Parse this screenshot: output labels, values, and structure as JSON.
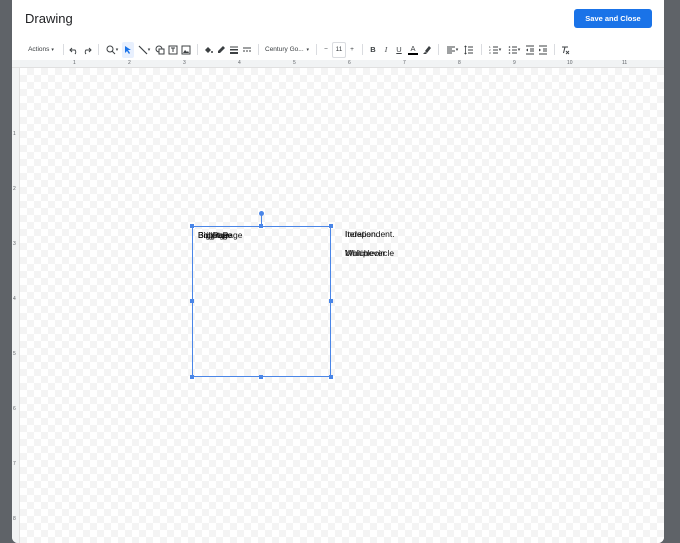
{
  "dialog": {
    "title": "Drawing",
    "save_close_label": "Save and Close"
  },
  "toolbar": {
    "actions_label": "Actions",
    "font_name": "Century Go...",
    "font_size": "11",
    "font_size_minus": "−",
    "font_size_plus": "+",
    "bold": "B",
    "italic": "I",
    "underline": "U",
    "text_color": "A"
  },
  "ruler": {
    "h_numbers": [
      "1",
      "2",
      "3",
      "4",
      "5",
      "6",
      "7",
      "8",
      "9",
      "10",
      "11"
    ],
    "v_numbers": [
      "1",
      "2",
      "3",
      "4",
      "5",
      "6",
      "7",
      "8"
    ]
  },
  "canvas": {
    "box_text_layers": [
      "Big Page",
      "Biggrape",
      "Bright Page",
      "Bollotge"
    ],
    "right_text_1_layers": [
      "Independent.",
      "Iteration."
    ],
    "right_text_2_layers": [
      "Whichever",
      "Multiplecircle"
    ]
  },
  "colors": {
    "accent": "#1a73e8",
    "selection": "#4a86e8"
  }
}
